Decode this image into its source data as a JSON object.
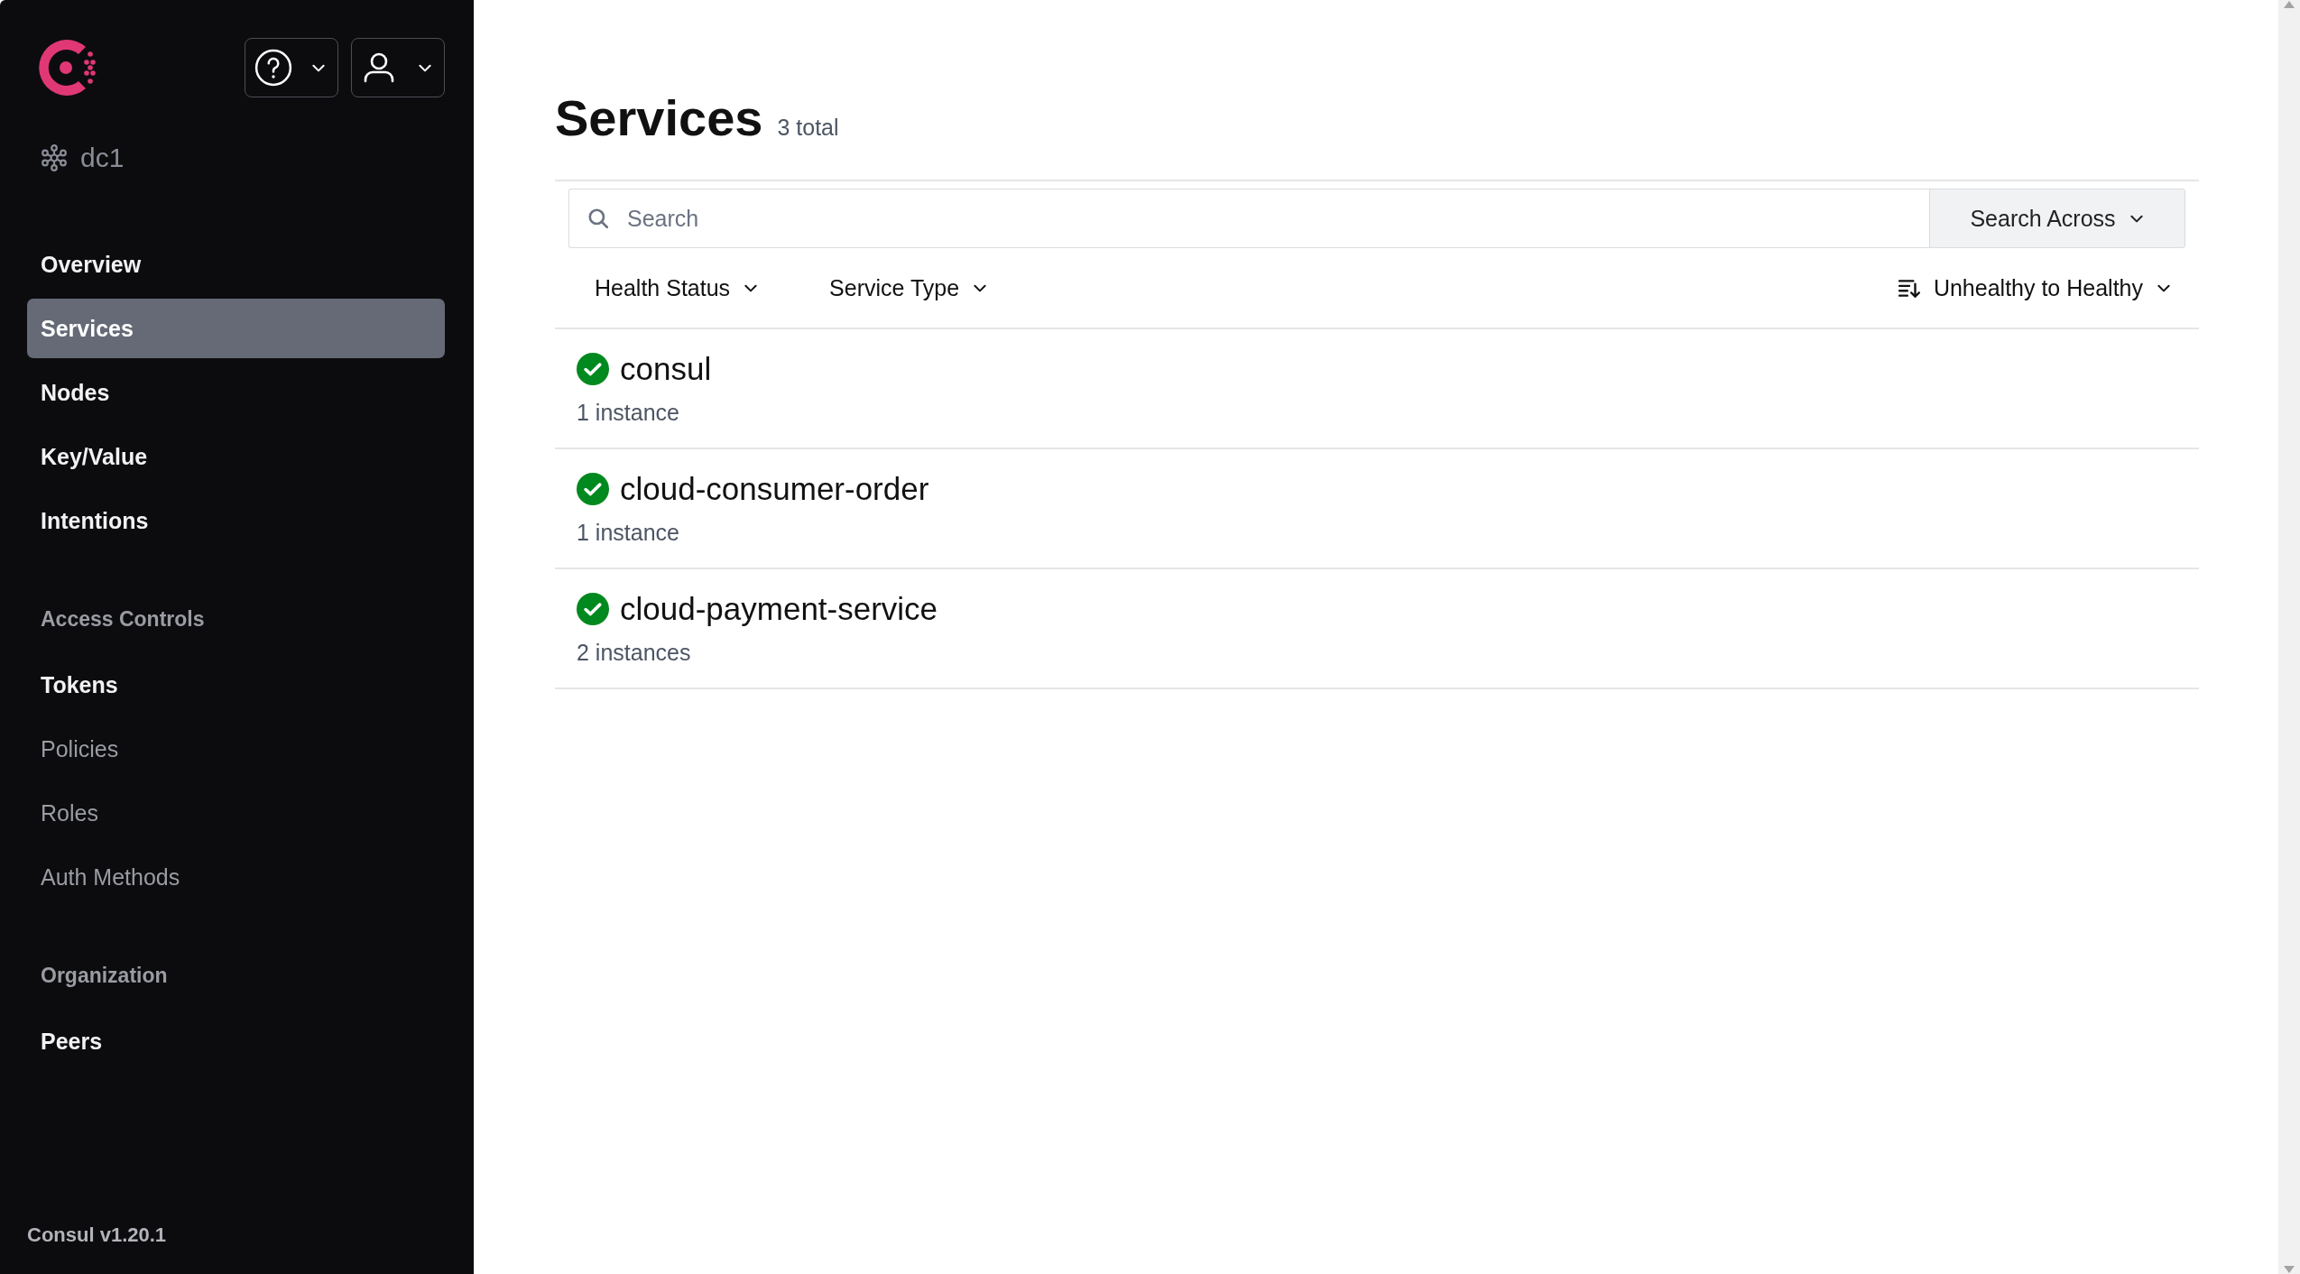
{
  "sidebar": {
    "datacenter": "dc1",
    "sections": [
      {
        "items": [
          {
            "label": "Overview",
            "selected": false,
            "disabled": false
          },
          {
            "label": "Services",
            "selected": true,
            "disabled": false
          },
          {
            "label": "Nodes",
            "selected": false,
            "disabled": false
          },
          {
            "label": "Key/Value",
            "selected": false,
            "disabled": false
          },
          {
            "label": "Intentions",
            "selected": false,
            "disabled": false
          }
        ]
      },
      {
        "heading": "Access Controls",
        "items": [
          {
            "label": "Tokens",
            "selected": false,
            "disabled": false
          },
          {
            "label": "Policies",
            "selected": false,
            "disabled": true
          },
          {
            "label": "Roles",
            "selected": false,
            "disabled": true
          },
          {
            "label": "Auth Methods",
            "selected": false,
            "disabled": true
          }
        ]
      },
      {
        "heading": "Organization",
        "items": [
          {
            "label": "Peers",
            "selected": false,
            "disabled": false
          }
        ]
      }
    ],
    "version": "Consul v1.20.1"
  },
  "page": {
    "title": "Services",
    "count": "3 total"
  },
  "search": {
    "placeholder": "Search",
    "scope_button": "Search Across"
  },
  "filters": [
    "Health Status",
    "Service Type"
  ],
  "sort": "Unhealthy to Healthy",
  "services": [
    {
      "name": "consul",
      "instances": "1 instance",
      "healthy": true
    },
    {
      "name": "cloud-consumer-order",
      "instances": "1 instance",
      "healthy": true
    },
    {
      "name": "cloud-payment-service",
      "instances": "2 instances",
      "healthy": true
    }
  ]
}
